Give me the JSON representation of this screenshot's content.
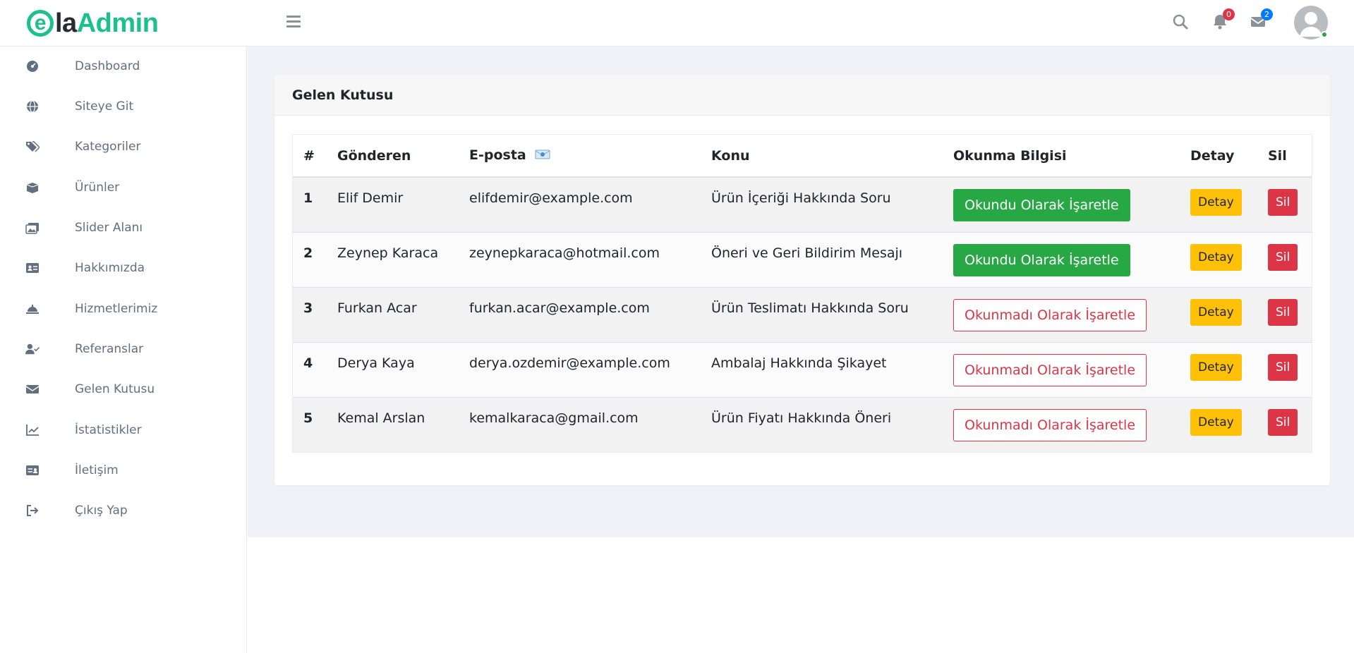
{
  "brand": {
    "logo_e": "e",
    "logo_la": "la",
    "logo_admin": "Admin"
  },
  "header": {
    "notifications_count": "0",
    "messages_count": "2"
  },
  "sidebar": {
    "items": [
      {
        "label": "Dashboard",
        "icon": "dashboard-icon"
      },
      {
        "label": "Siteye Git",
        "icon": "globe-icon"
      },
      {
        "label": "Kategoriler",
        "icon": "tags-icon"
      },
      {
        "label": "Ürünler",
        "icon": "box-icon"
      },
      {
        "label": "Slider Alanı",
        "icon": "images-icon"
      },
      {
        "label": "Hakkımızda",
        "icon": "id-card-icon"
      },
      {
        "label": "Hizmetlerimiz",
        "icon": "concierge-bell-icon"
      },
      {
        "label": "Referanslar",
        "icon": "user-check-icon"
      },
      {
        "label": "Gelen Kutusu",
        "icon": "envelope-icon"
      },
      {
        "label": "İstatistikler",
        "icon": "chart-line-icon"
      },
      {
        "label": "İletişim",
        "icon": "address-card-icon"
      },
      {
        "label": "Çıkış Yap",
        "icon": "sign-out-icon"
      }
    ]
  },
  "card": {
    "title": "Gelen Kutusu"
  },
  "table": {
    "headers": {
      "index": "#",
      "sender": "Gönderen",
      "email": "E-posta",
      "subject": "Konu",
      "read_status": "Okunma Bilgisi",
      "detail": "Detay",
      "delete": "Sil"
    },
    "rows": [
      {
        "index": "1",
        "sender": "Elif Demir",
        "email": "elifdemir@example.com",
        "subject": "Ürün İçeriği Hakkında Soru",
        "action": "Okundu Olarak İşaretle",
        "read": true,
        "detail": "Detay",
        "delete": "Sil"
      },
      {
        "index": "2",
        "sender": "Zeynep Karaca",
        "email": "zeynepkaraca@hotmail.com",
        "subject": "Öneri ve Geri Bildirim Mesajı",
        "action": "Okundu Olarak İşaretle",
        "read": true,
        "detail": "Detay",
        "delete": "Sil"
      },
      {
        "index": "3",
        "sender": "Furkan Acar",
        "email": "furkan.acar@example.com",
        "subject": "Ürün Teslimatı Hakkında Soru",
        "action": "Okunmadı Olarak İşaretle",
        "read": false,
        "detail": "Detay",
        "delete": "Sil"
      },
      {
        "index": "4",
        "sender": "Derya Kaya",
        "email": "derya.ozdemir@example.com",
        "subject": "Ambalaj Hakkında Şikayet",
        "action": "Okunmadı Olarak İşaretle",
        "read": false,
        "detail": "Detay",
        "delete": "Sil"
      },
      {
        "index": "5",
        "sender": "Kemal Arslan",
        "email": "kemalkaraca@gmail.com",
        "subject": "Ürün Fiyatı Hakkında Öneri",
        "action": "Okunmadı Olarak İşaretle",
        "read": false,
        "detail": "Detay",
        "delete": "Sil"
      }
    ]
  },
  "colors": {
    "brand_green": "#1cc08a",
    "success": "#28a745",
    "danger": "#dc3545",
    "warning": "#ffc107",
    "sidebar_text": "#607080",
    "content_bg": "#f1f2f7"
  }
}
